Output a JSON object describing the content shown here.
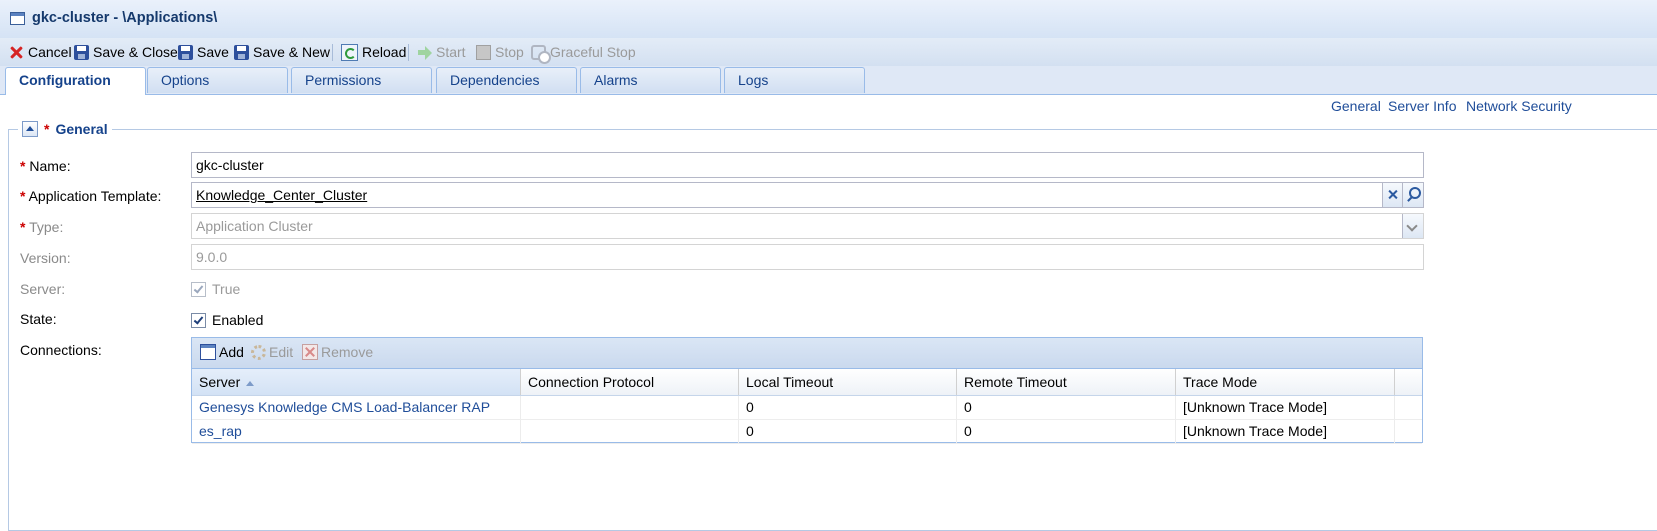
{
  "window": {
    "title": "gkc-cluster - \\Applications\\"
  },
  "toolbar": {
    "cancel": "Cancel",
    "save_close": "Save & Close",
    "save": "Save",
    "save_new": "Save & New",
    "reload": "Reload",
    "start": "Start",
    "stop": "Stop",
    "graceful_stop": "Graceful Stop"
  },
  "tabs": [
    "Configuration",
    "Options",
    "Permissions",
    "Dependencies",
    "Alarms",
    "Logs"
  ],
  "section_links": [
    "General",
    "Server Info",
    "Network Security"
  ],
  "general": {
    "legend": "General",
    "required_mark": "*",
    "fields": {
      "name": {
        "label": "Name:",
        "value": "gkc-cluster"
      },
      "template": {
        "label": "Application Template:",
        "value": "Knowledge_Center_Cluster"
      },
      "type": {
        "label": "Type:",
        "value": "Application Cluster"
      },
      "version": {
        "label": "Version:",
        "value": "9.0.0"
      },
      "server": {
        "label": "Server:",
        "value": "True",
        "checked": true
      },
      "state": {
        "label": "State:",
        "value": "Enabled",
        "checked": true
      },
      "connections": {
        "label": "Connections:"
      }
    }
  },
  "connections": {
    "toolbar": {
      "add": "Add",
      "edit": "Edit",
      "remove": "Remove"
    },
    "columns": [
      "Server",
      "Connection Protocol",
      "Local Timeout",
      "Remote Timeout",
      "Trace Mode"
    ],
    "sorted_column": "Server",
    "rows": [
      [
        "Genesys Knowledge CMS Load-Balancer RAP",
        "",
        "0",
        "0",
        "[Unknown Trace Mode]"
      ],
      [
        "es_rap",
        "",
        "0",
        "0",
        "[Unknown Trace Mode]"
      ]
    ]
  },
  "colors": {
    "accent": "#15428b",
    "link": "#1f4d99",
    "required": "#cc0000",
    "tab_border": "#99bbe8"
  }
}
